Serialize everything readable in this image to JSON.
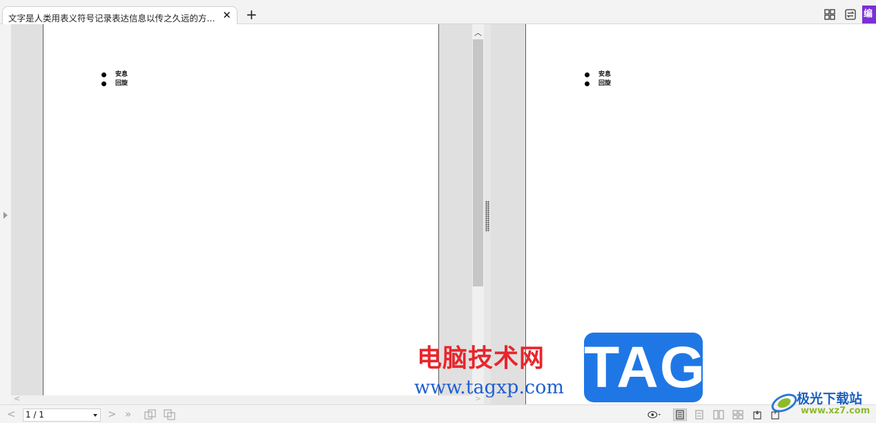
{
  "tabs": [
    {
      "title": "文字是人类用表义符号记录表达信息以传之久远的方..."
    }
  ],
  "document": {
    "bullets": [
      "安息",
      "回旋"
    ]
  },
  "statusbar": {
    "page_indicator": "1 / 1"
  },
  "toolbar_right": {
    "edit_label": "编"
  },
  "watermark": {
    "site_name_cn": "电脑技术网",
    "site_url": "www.tagxp.com",
    "tag_badge": "TAG",
    "logo_cn": "极光下载站",
    "logo_url": "www.xz7.com"
  },
  "colors": {
    "accent_purple": "#7b2fd6",
    "watermark_red": "#e8262c",
    "watermark_blue": "#1f77e6"
  },
  "icons": {
    "tab_close": "close-icon",
    "new_tab": "plus-icon",
    "grid_view": "grid-icon",
    "convert": "convert-icon",
    "scroll_up": "chevron-up-icon",
    "scroll_left": "chevron-left-icon",
    "scroll_right": "chevron-right-icon",
    "prev_page": "chevron-left-icon",
    "next_page": "chevron-right-icon",
    "last_page": "double-chevron-right-icon"
  }
}
